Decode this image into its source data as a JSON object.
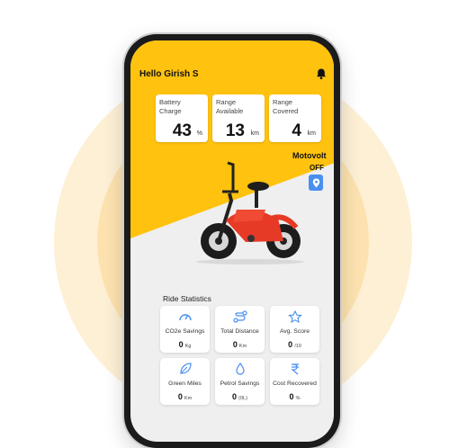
{
  "header": {
    "greeting": "Hello Girish S"
  },
  "stats": [
    {
      "label": "Battery\nCharge",
      "value": "43",
      "unit": "%"
    },
    {
      "label": "Range\nAvailable",
      "value": "13",
      "unit": "km"
    },
    {
      "label": "Range\nCovered",
      "value": "4",
      "unit": "km"
    }
  ],
  "vehicle": {
    "brand": "Motovolt",
    "power_state": "OFF"
  },
  "ride_statistics": {
    "title": "Ride Statistics",
    "cards": [
      {
        "label": "CO2e Savings",
        "value": "0",
        "unit": "Kg",
        "icon": "speedometer-icon"
      },
      {
        "label": "Total Distance",
        "value": "0",
        "unit": "Km",
        "icon": "route-icon"
      },
      {
        "label": "Avg. Score",
        "value": "0",
        "unit": "/10",
        "icon": "star-icon"
      },
      {
        "label": "Green Miles",
        "value": "0",
        "unit": "Km",
        "icon": "leaf-icon"
      },
      {
        "label": "Petrol Savings",
        "value": "0",
        "unit": "(0L)",
        "icon": "droplet-icon"
      },
      {
        "label": "Cost Recovered",
        "value": "0",
        "unit": "%",
        "icon": "rupee-icon"
      }
    ]
  },
  "colors": {
    "accent": "#ffc20e",
    "icon_blue": "#4a8ff0",
    "halo": "#fde2b0"
  }
}
